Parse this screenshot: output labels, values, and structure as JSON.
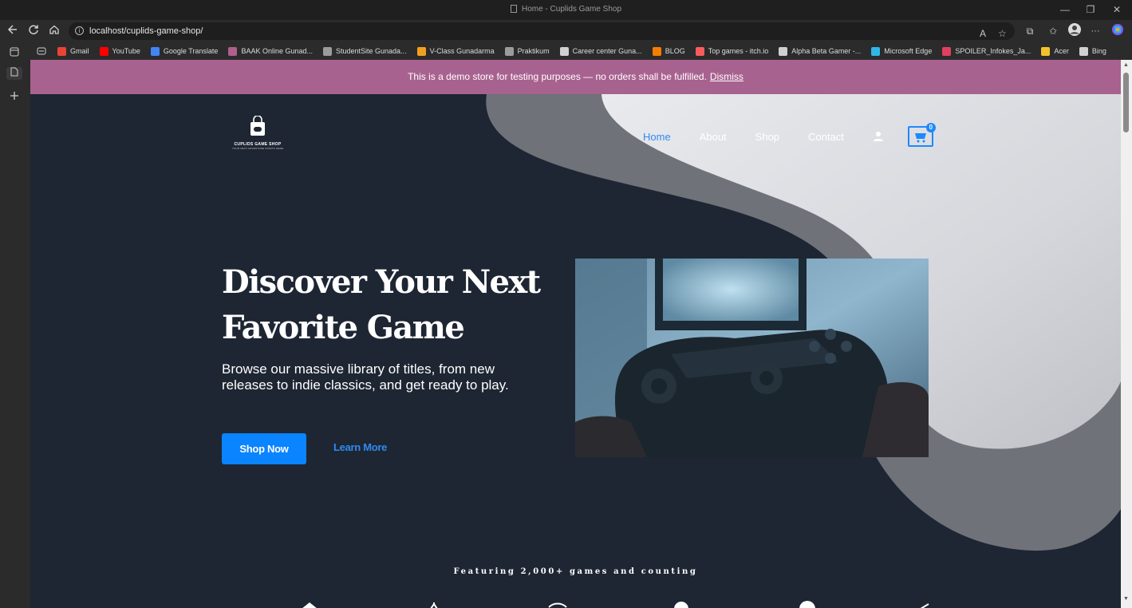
{
  "window": {
    "title": "Home - Cuplids Game Shop",
    "minimize": "—",
    "restore": "❐",
    "close": "✕"
  },
  "toolbar": {
    "url": "localhost/cuplids-game-shop/",
    "info_glyph": "i",
    "read_aloud_glyph": "A",
    "favorite_glyph": "☆",
    "extensions_glyph": "⧉",
    "collections_glyph": "✩",
    "more_glyph": "···"
  },
  "bookmarks": [
    {
      "label": "Gmail",
      "color": "#ea4335"
    },
    {
      "label": "YouTube",
      "color": "#ff0000"
    },
    {
      "label": "Google Translate",
      "color": "#4285f4"
    },
    {
      "label": "BAAK Online Gunad...",
      "color": "#b05f8a"
    },
    {
      "label": "StudentSite Gunada...",
      "color": "#9b9b9b"
    },
    {
      "label": "V-Class Gunadarma",
      "color": "#f0a020"
    },
    {
      "label": "Praktikum",
      "color": "#9b9b9b"
    },
    {
      "label": "Career center Guna...",
      "color": "#d0d0d0"
    },
    {
      "label": "BLOG",
      "color": "#f57d00"
    },
    {
      "label": "Top games - itch.io",
      "color": "#fa5c5c"
    },
    {
      "label": "Alpha Beta Gamer -...",
      "color": "#cfcfcf"
    },
    {
      "label": "Microsoft Edge",
      "color": "#2fb6e8"
    },
    {
      "label": "SPOILER_Infokes_Ja...",
      "color": "#e04060"
    },
    {
      "label": "Acer",
      "color": "#f2c12e"
    },
    {
      "label": "Bing",
      "color": "#d0d0d0"
    }
  ],
  "demo_notice": {
    "text": "This is a demo store for testing purposes — no orders shall be fulfilled.",
    "dismiss": "Dismiss"
  },
  "site": {
    "logo_name": "CUPLIDS GAME SHOP",
    "logo_tagline": "YOUR NEXT ADVENTURE STARTS HERE",
    "nav": {
      "home": "Home",
      "about": "About",
      "shop": "Shop",
      "contact": "Contact"
    },
    "cart_count": "0"
  },
  "hero": {
    "headline_line1": "Discover Your Next",
    "headline_line2": "Favorite Game",
    "subtitle": "Browse our massive library of titles, from new releases to indie classics, and get ready to play.",
    "primary_button": "Shop Now",
    "secondary_button": "Learn More"
  },
  "featuring": "Featuring 2,000+ games and counting",
  "colors": {
    "accent": "#0a84ff",
    "notice_bar": "#a8628f",
    "hero_dark": "#1e2633"
  }
}
